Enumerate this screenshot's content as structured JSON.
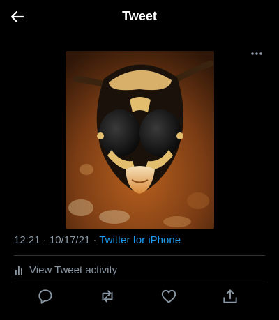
{
  "header": {
    "title": "Tweet"
  },
  "tweet": {
    "timestamp": "12:21 · 10/17/21 · ",
    "source": "Twitter for iPhone"
  },
  "activity": {
    "label": "View Tweet activity"
  },
  "colors": {
    "background": "#000000",
    "text_primary": "#ffffff",
    "text_secondary": "#8b98a5",
    "accent": "#1d9bf0",
    "divider": "#2f3336"
  },
  "icons": {
    "back": "arrow-left-icon",
    "more": "more-horizontal-icon",
    "activity": "bar-chart-icon",
    "reply": "reply-icon",
    "retweet": "retweet-icon",
    "like": "heart-icon",
    "share": "share-icon"
  }
}
